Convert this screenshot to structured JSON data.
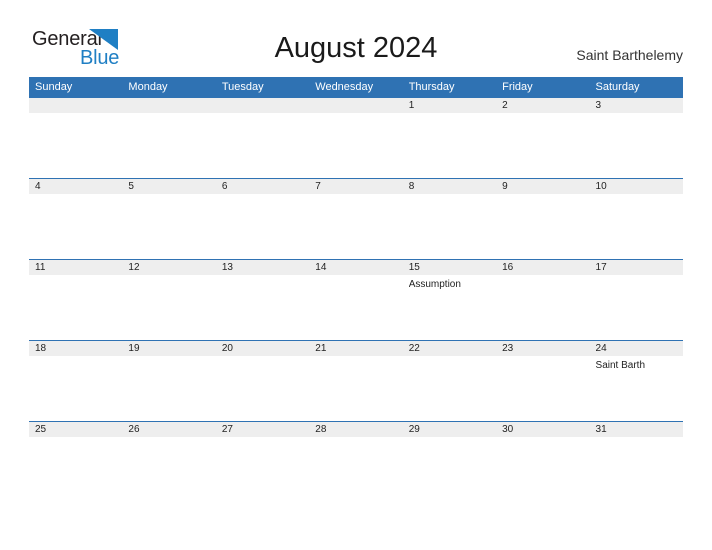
{
  "brand": {
    "name_part1": "General",
    "name_part2": "Blue",
    "flag_icon": "triangle-flag-icon",
    "color_dark": "#231f20",
    "color_blue": "#1f7fc4"
  },
  "header": {
    "title": "August 2024",
    "location": "Saint Barthelemy"
  },
  "calendar": {
    "accent_color": "#2f72b3",
    "band_color": "#eeeeee",
    "weekdays": [
      "Sunday",
      "Monday",
      "Tuesday",
      "Wednesday",
      "Thursday",
      "Friday",
      "Saturday"
    ],
    "weeks": [
      [
        {
          "date": "",
          "event": ""
        },
        {
          "date": "",
          "event": ""
        },
        {
          "date": "",
          "event": ""
        },
        {
          "date": "",
          "event": ""
        },
        {
          "date": "1",
          "event": ""
        },
        {
          "date": "2",
          "event": ""
        },
        {
          "date": "3",
          "event": ""
        }
      ],
      [
        {
          "date": "4",
          "event": ""
        },
        {
          "date": "5",
          "event": ""
        },
        {
          "date": "6",
          "event": ""
        },
        {
          "date": "7",
          "event": ""
        },
        {
          "date": "8",
          "event": ""
        },
        {
          "date": "9",
          "event": ""
        },
        {
          "date": "10",
          "event": ""
        }
      ],
      [
        {
          "date": "11",
          "event": ""
        },
        {
          "date": "12",
          "event": ""
        },
        {
          "date": "13",
          "event": ""
        },
        {
          "date": "14",
          "event": ""
        },
        {
          "date": "15",
          "event": "Assumption"
        },
        {
          "date": "16",
          "event": ""
        },
        {
          "date": "17",
          "event": ""
        }
      ],
      [
        {
          "date": "18",
          "event": ""
        },
        {
          "date": "19",
          "event": ""
        },
        {
          "date": "20",
          "event": ""
        },
        {
          "date": "21",
          "event": ""
        },
        {
          "date": "22",
          "event": ""
        },
        {
          "date": "23",
          "event": ""
        },
        {
          "date": "24",
          "event": "Saint Barth"
        }
      ],
      [
        {
          "date": "25",
          "event": ""
        },
        {
          "date": "26",
          "event": ""
        },
        {
          "date": "27",
          "event": ""
        },
        {
          "date": "28",
          "event": ""
        },
        {
          "date": "29",
          "event": ""
        },
        {
          "date": "30",
          "event": ""
        },
        {
          "date": "31",
          "event": ""
        }
      ]
    ]
  }
}
